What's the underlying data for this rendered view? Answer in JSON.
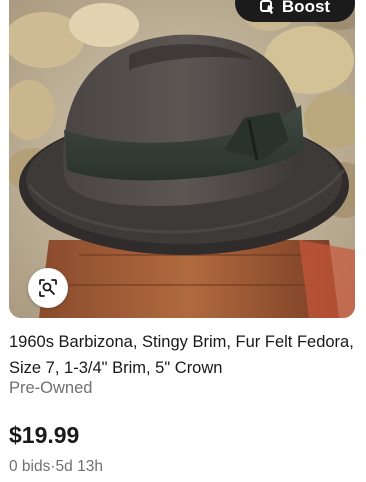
{
  "listing": {
    "boost_label": "Boost",
    "title": "1960s Barbizona, Stingy Brim, Fur Felt Fedora, Size 7, 1-3/4\" Brim, 5\" Crown",
    "condition": "Pre-Owned",
    "price": "$19.99",
    "bids": "0 bids",
    "separator": "·",
    "time_left": "5d 13h"
  },
  "icons": {
    "boost": "boost-icon",
    "visual_search": "visual-search-icon"
  },
  "colors": {
    "text_primary": "#191919",
    "text_secondary": "#707070",
    "chip_bg": "#1b1b1b"
  }
}
